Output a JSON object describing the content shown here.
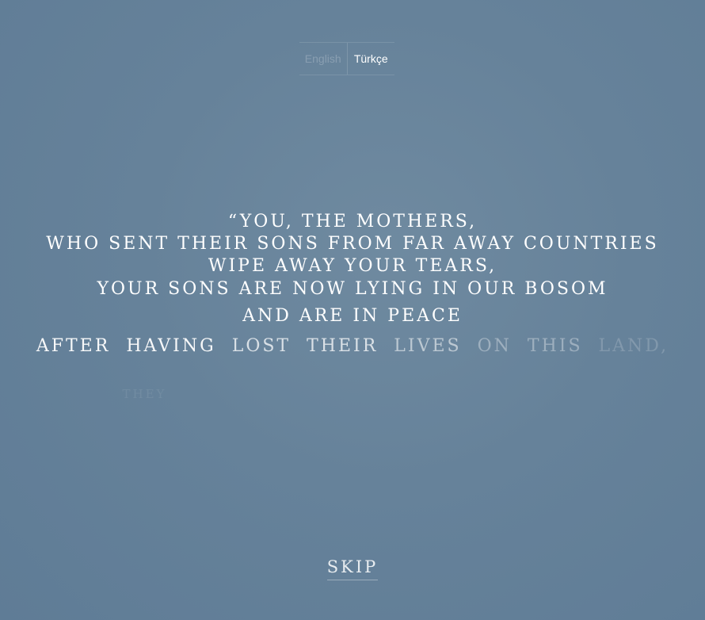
{
  "language_switch": {
    "options": [
      {
        "label": "English",
        "state": "inactive"
      },
      {
        "label": "Türkçe",
        "state": "active"
      }
    ]
  },
  "quote": {
    "lines": [
      "“YOU, THE  MOTHERS,",
      "WHO SENT THEIR SONS FROM FAR AWAY COUNTRIES",
      "WIPE AWAY YOUR TEARS,",
      "YOUR SONS ARE NOW LYING IN OUR BOSOM",
      "AND ARE IN PEACE"
    ],
    "line6_words": [
      "AFTER",
      "HAVING",
      "LOST",
      "THEIR",
      "LIVES",
      "ON",
      "THIS",
      "LAND,"
    ],
    "line7_words": [
      "THEY"
    ]
  },
  "skip_label": "SKIP",
  "colors": {
    "background": "#66829a",
    "text": "#ffffff"
  }
}
